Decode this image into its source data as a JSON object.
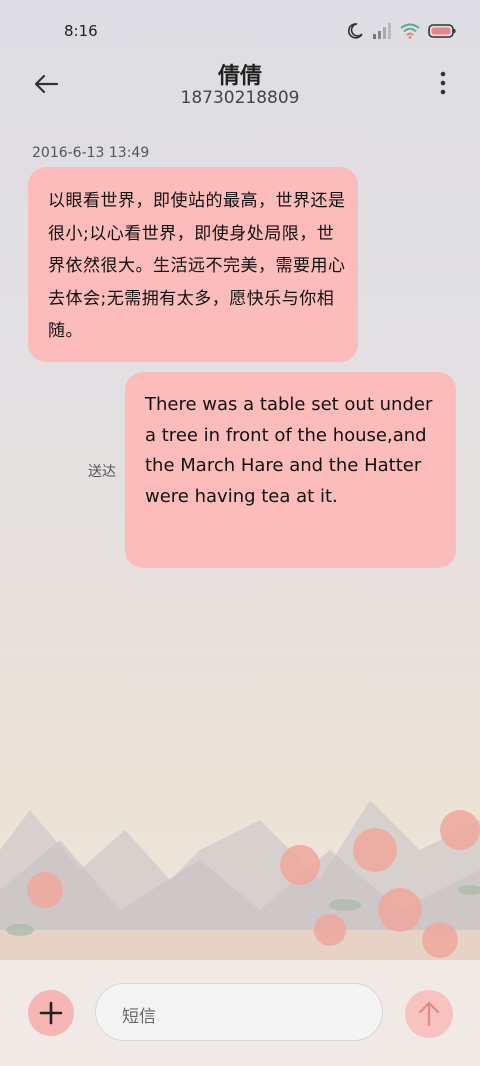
{
  "status_bar": {
    "time": "8:16",
    "icons": [
      "moon-icon",
      "signal-icon",
      "wifi-icon",
      "battery-icon"
    ]
  },
  "header": {
    "contact_name": "倩倩",
    "phone_number": "18730218809",
    "back_icon": "arrow-left-icon",
    "more_icon": "more-vertical-icon"
  },
  "messages": [
    {
      "direction": "incoming",
      "date": "2016-6-13 13:49",
      "text": "以眼看世界，即使站的最高，世界还是很小;以心看世界，即使身处局限，世界依然很大。生活远不完美，需要用心去体会;无需拥有太多，愿快乐与你相随。"
    },
    {
      "direction": "outgoing",
      "status": "送达",
      "text": "There was a table set out under a tree in front of the house,and the March Hare and the Hatter were having tea at it."
    }
  ],
  "composer": {
    "placeholder": "短信",
    "add_icon": "plus-icon",
    "send_icon": "arrow-up-icon"
  },
  "colors": {
    "bubble": "#fbbcbb",
    "accent": "#f6b6b3"
  }
}
